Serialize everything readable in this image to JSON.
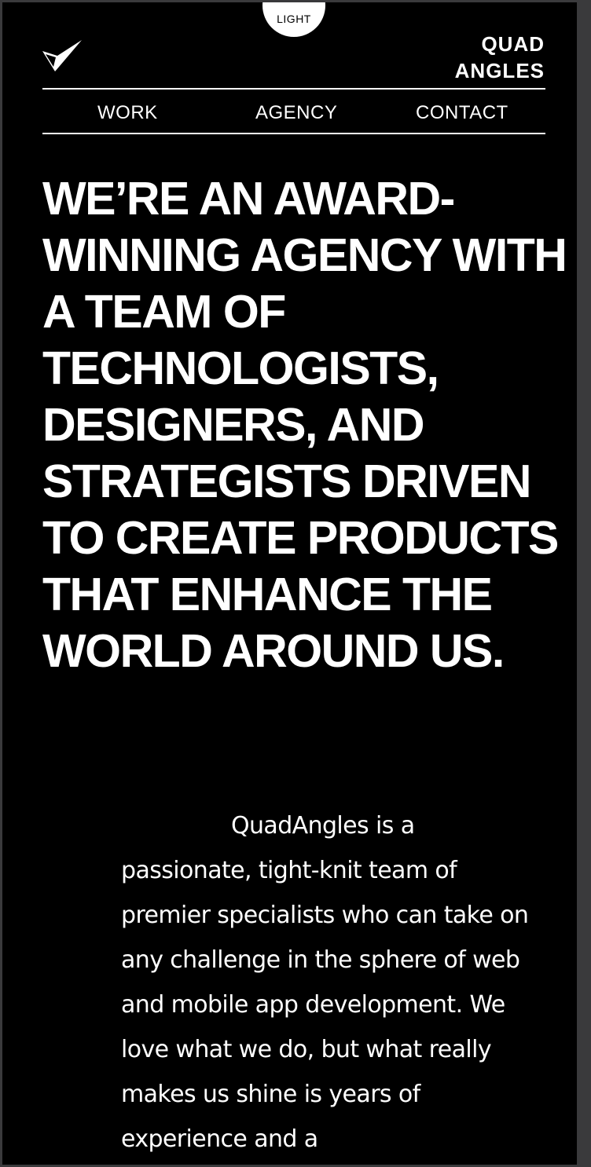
{
  "theme_toggle": {
    "label": "LIGHT"
  },
  "brand": {
    "line1": "QUAD",
    "line2": "ANGLES"
  },
  "nav": {
    "items": [
      "WORK",
      "AGENCY",
      "CONTACT"
    ]
  },
  "hero": {
    "headline": "WE’RE AN AWARD-WINNING AGENCY WITH A TEAM OF TECHNOLOGISTS, DESIGNERS, AND STRATEGISTS DRIVEN TO CREATE PRODUCTS THAT ENHANCE THE WORLD AROUND US."
  },
  "intro": {
    "text": "QuadAngles is a passionate, tight-knit team of premier specialists who can take on any challenge in the sphere of web and mobile app development. We love what we do, but what really makes us shine is years of experience and a"
  },
  "colors": {
    "background": "#000000",
    "foreground": "#ffffff",
    "chrome": "#3a3a3c"
  },
  "icons": {
    "logo": "checkmark-logo-icon"
  }
}
